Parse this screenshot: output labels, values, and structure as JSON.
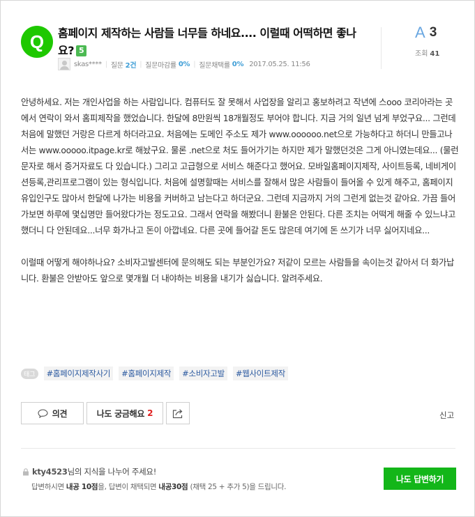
{
  "question": {
    "badge": "Q",
    "title": "홈페이지 제작하는 사람들 너무들 하네요.... 이럴때 어떡하면 좋나요?",
    "level": "5"
  },
  "meta": {
    "user": "skas****",
    "questions_label": "질문",
    "questions_value": "2건",
    "deadline_label": "질문마감률",
    "deadline_value": "0%",
    "adopt_label": "질문채택률",
    "adopt_value": "0%",
    "date": "2017.05.25. 11:56"
  },
  "stats": {
    "answer_icon": "A",
    "answer_count": "3",
    "views_label": "조회",
    "views_value": "41"
  },
  "body": {
    "paragraph1": "안녕하세요. 저는 개인사업을 하는 사람입니다. 컴퓨터도 잘 못해서 사업장을 알리고 홍보하려고 작년에 스ooo 코리아라는 곳에서 연락이 와서 홈피제작을 했었습니다. 한달에 8만원씩 18개월정도 부어야 합니다. 지금 거의 일년 넘게 부었구요... 그런데 처음에 말했던 거랑은 다르게 하더라고요. 처음에는 도메인 주소도 제가 www.oooooo.net으로 가능하다고 하더니 만들고나서는 www.ooooo.itpage.kr로 해놨구요. 물론 .net으로 처도 들어가기는 하지만 제가 말했던것은 그게 아니였는데요... (물런 문자로 해서 증거자료도 다 있습니다.) 그리고 고급형으로 서비스 해준다고 했어요. 모바일홈페이지제작, 사이트등록, 네비게이션등록,관리프로그램이 있는 형식입니다. 처음에 설명할때는 서비스를 잘해서 많은 사람들이 들어올 수 있게 해주고, 홈페이지 유입인구도 많아서 한달에 나가는 비용을 커버하고 남는다고 하더군요. 그런데 지금까지 거의 그런게 없는것 같아요. 가끔 들어가보면 하루에 몇십명만 들어왔다가는 정도고요. 그래서 연락을 해봤더니 환불은 안된다. 다른 조치는 어떡게 해줄 수 있느냐고 했더니 다 안된데요...너무 화가나고 돈이 아깝네요. 다른 곳에 들어갈 돈도 많은데 여기에 돈 쓰기가 너무 싫어지네요...",
    "paragraph2": "이럴때 어떻게 해야하나요? 소비자고발센터에 문의해도 되는 부분인가요? 저같이 모르는 사람들을 속이는것 같아서 더 화가납니다. 환불은 안받아도 앞으로 몇개월 더 내야하는 비용을 내기가 싫습니다. 알려주세요."
  },
  "tags": {
    "label": "태그",
    "items": [
      "#홈페이지제작사기",
      "#홈페이지제작",
      "#소비자고발",
      "#웹사이트제작"
    ]
  },
  "actions": {
    "opinion": "의견",
    "curious": "나도 궁금해요",
    "curious_count": "2",
    "report": "신고"
  },
  "footer": {
    "user": "kty4523",
    "line1_rest": "님의 지식을 나누어 주세요!",
    "line2_a": "답변하시면 ",
    "line2_b": "내공 10점",
    "line2_c": "을, 답변이 채택되면 ",
    "line2_d": "내공30점",
    "line2_e": " (채택 25 + 추가 5)을 드립니다.",
    "answer_button": "나도 답변하기"
  },
  "colors": {
    "brand_green": "#1ec800",
    "answer_button": "#13b619",
    "tag_text": "#2c5aa0",
    "stat_highlight": "#3d9dd6"
  }
}
